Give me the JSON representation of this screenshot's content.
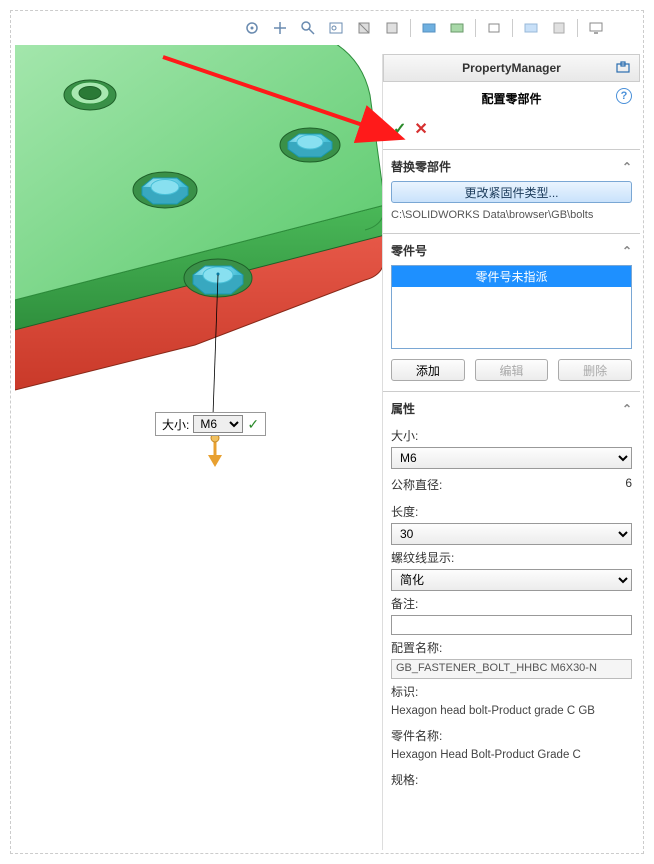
{
  "toolbar": {
    "icons": [
      "orbit",
      "pan",
      "zoom",
      "fit",
      "section",
      "display-style",
      "shaded",
      "hidden-lines",
      "wireframe",
      "shadow",
      "scene",
      "render",
      "screen"
    ]
  },
  "callout": {
    "label": "大小:",
    "value": "M6"
  },
  "pm": {
    "title": "PropertyManager",
    "subtitle": "配置零部件",
    "sections": {
      "replace": {
        "title": "替换零部件",
        "button": "更改紧固件类型...",
        "path": "C:\\SOLIDWORKS Data\\browser\\GB\\bolts"
      },
      "partnum": {
        "title": "零件号",
        "list_item": "零件号未指派",
        "add": "添加",
        "edit": "编辑",
        "delete": "删除"
      },
      "props": {
        "title": "属性",
        "size_label": "大小:",
        "size_value": "M6",
        "nominal_label": "公称直径:",
        "nominal_value": "6",
        "length_label": "长度:",
        "length_value": "30",
        "thread_label": "螺纹线显示:",
        "thread_value": "简化",
        "comment_label": "备注:",
        "comment_value": "",
        "config_label": "配置名称:",
        "config_value": "GB_FASTENER_BOLT_HHBC M6X30-N",
        "mark_label": "标识:",
        "mark_value": "Hexagon head bolt-Product grade C GB",
        "partname_label": "零件名称:",
        "partname_value": "Hexagon Head Bolt-Product Grade C",
        "spec_label": "规格:"
      }
    }
  }
}
